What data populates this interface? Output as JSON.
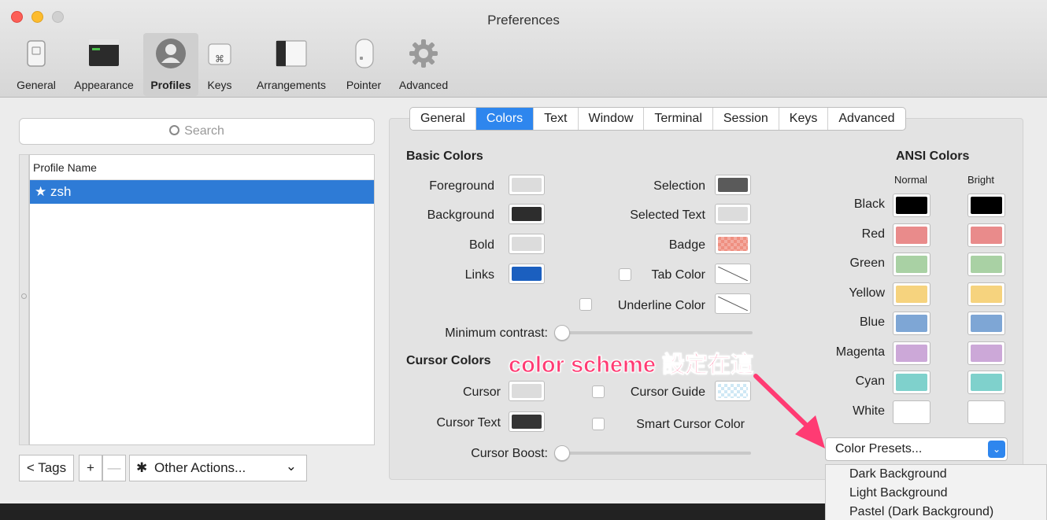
{
  "window": {
    "title": "Preferences"
  },
  "toolbar": {
    "items": [
      {
        "label": "General"
      },
      {
        "label": "Appearance"
      },
      {
        "label": "Profiles"
      },
      {
        "label": "Keys"
      },
      {
        "label": "Arrangements"
      },
      {
        "label": "Pointer"
      },
      {
        "label": "Advanced"
      }
    ],
    "keys_glyph": "⌘"
  },
  "profiles": {
    "search_placeholder": "Search",
    "column_header": "Profile Name",
    "items": [
      {
        "name": "★ zsh",
        "selected": true
      }
    ],
    "tags_label": "< Tags",
    "add_label": "+",
    "remove_label": "—",
    "other_actions_label": "Other Actions...",
    "other_actions_arrow": "⌄",
    "gear_glyph": "✱"
  },
  "tabs": [
    "General",
    "Colors",
    "Text",
    "Window",
    "Terminal",
    "Session",
    "Keys",
    "Advanced"
  ],
  "active_tab": "Colors",
  "basic_colors": {
    "heading": "Basic Colors",
    "foreground": {
      "label": "Foreground",
      "color": "#dcdcdc"
    },
    "background": {
      "label": "Background",
      "color": "#2d2d2d"
    },
    "bold": {
      "label": "Bold",
      "color": "#dcdcdc"
    },
    "links": {
      "label": "Links",
      "color": "#1b5fbf"
    },
    "selection": {
      "label": "Selection",
      "color": "#5a5a5a"
    },
    "selected_text": {
      "label": "Selected Text",
      "color": "#dcdcdc"
    },
    "badge": {
      "label": "Badge",
      "color": "#ef8f80"
    },
    "tab_color": {
      "label": "Tab Color"
    },
    "underline_color": {
      "label": "Underline Color"
    },
    "minimum_contrast": {
      "label": "Minimum contrast:",
      "value": 0
    }
  },
  "cursor_colors": {
    "heading": "Cursor Colors",
    "cursor": {
      "label": "Cursor",
      "color": "#dcdcdc"
    },
    "cursor_text": {
      "label": "Cursor Text",
      "color": "#353535"
    },
    "cursor_guide": {
      "label": "Cursor Guide",
      "color": "#cfe8f5"
    },
    "smart_cursor_color": {
      "label": "Smart Cursor Color"
    },
    "cursor_boost": {
      "label": "Cursor Boost:",
      "value": 0
    }
  },
  "ansi_colors": {
    "heading": "ANSI Colors",
    "normal_label": "Normal",
    "bright_label": "Bright",
    "rows": [
      {
        "name": "Black",
        "normal": "#000000",
        "bright": "#000000"
      },
      {
        "name": "Red",
        "normal": "#e98b8b",
        "bright": "#e98b8b"
      },
      {
        "name": "Green",
        "normal": "#a9d1a4",
        "bright": "#a9d1a4"
      },
      {
        "name": "Yellow",
        "normal": "#f6d37e",
        "bright": "#f6d37e"
      },
      {
        "name": "Blue",
        "normal": "#7ea6d5",
        "bright": "#7ea6d5"
      },
      {
        "name": "Magenta",
        "normal": "#cca8d8",
        "bright": "#cca8d8"
      },
      {
        "name": "Cyan",
        "normal": "#7fd1cc",
        "bright": "#7fd1cc"
      },
      {
        "name": "White",
        "normal": "#ffffff",
        "bright": "#ffffff"
      }
    ]
  },
  "color_presets": {
    "label": "Color Presets...",
    "arrow": "⌄",
    "menu_items": [
      "Dark Background",
      "Light Background",
      "Pastel (Dark Background)"
    ]
  },
  "annotation": "color scheme 設定在這",
  "colors": {
    "accent": "#2e86ee",
    "annotation": "#ff3b73"
  }
}
